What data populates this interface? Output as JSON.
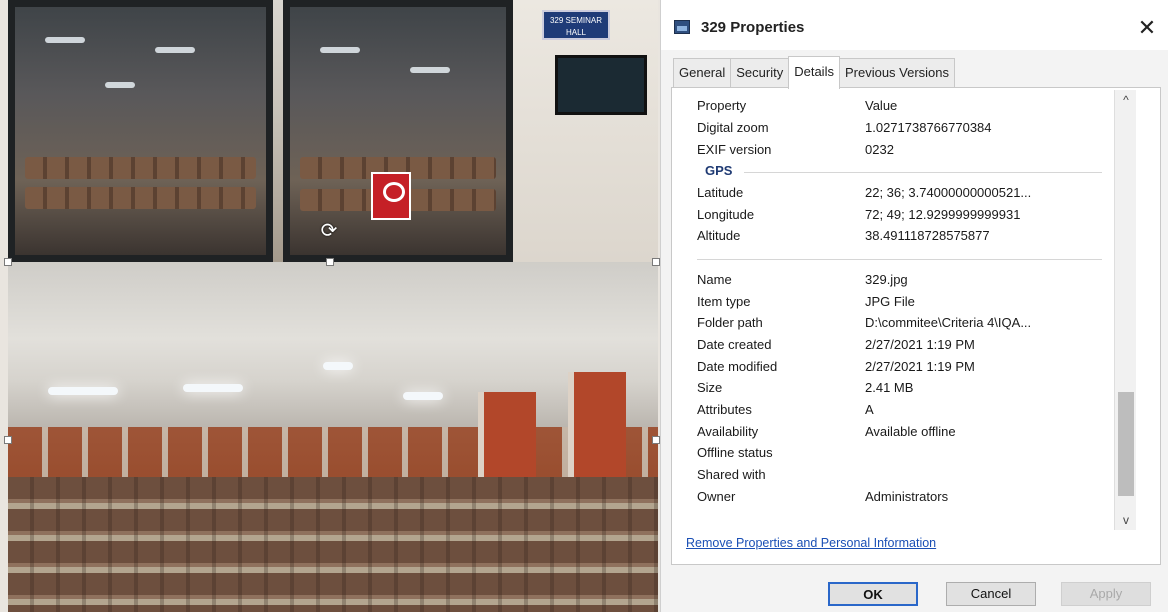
{
  "dialog": {
    "title": "329 Properties",
    "close_glyph": "✕",
    "tabs": [
      {
        "label": "General",
        "active": false
      },
      {
        "label": "Security",
        "active": false
      },
      {
        "label": "Details",
        "active": true
      },
      {
        "label": "Previous Versions",
        "active": false
      }
    ],
    "columns": {
      "property": "Property",
      "value": "Value"
    },
    "rows": [
      {
        "key": "Digital zoom",
        "value": "1.0271738766770384"
      },
      {
        "key": "EXIF version",
        "value": "0232"
      },
      {
        "group": "GPS"
      },
      {
        "key": "Latitude",
        "value": "22; 36; 3.74000000000521..."
      },
      {
        "key": "Longitude",
        "value": "72; 49; 12.9299999999931"
      },
      {
        "key": "Altitude",
        "value": "38.491118728575877"
      },
      {
        "group": ""
      },
      {
        "key": "Name",
        "value": "329.jpg"
      },
      {
        "key": "Item type",
        "value": "JPG File"
      },
      {
        "key": "Folder path",
        "value": "D:\\commitee\\Criteria 4\\IQA..."
      },
      {
        "key": "Date created",
        "value": "2/27/2021 1:19 PM"
      },
      {
        "key": "Date modified",
        "value": "2/27/2021 1:19 PM"
      },
      {
        "key": "Size",
        "value": "2.41 MB"
      },
      {
        "key": "Attributes",
        "value": "A"
      },
      {
        "key": "Availability",
        "value": "Available offline"
      },
      {
        "key": "Offline status",
        "value": ""
      },
      {
        "key": "Shared with",
        "value": ""
      },
      {
        "key": "Owner",
        "value": "Administrators"
      }
    ],
    "scroll_up_glyph": "^",
    "scroll_down_glyph": "v",
    "remove_link": "Remove Properties and Personal Information",
    "buttons": {
      "ok": "OK",
      "cancel": "Cancel",
      "apply": "Apply"
    }
  },
  "photo": {
    "sign_text": "329 SEMINAR HALL",
    "rotate_glyph": "⟳"
  },
  "icons": {
    "title": "image-file-icon",
    "close": "close-icon",
    "rotate": "rotate-icon",
    "layout": "layout-options-icon"
  },
  "colors": {
    "link": "#1a4fb5",
    "group_header": "#1f3a73",
    "ok_border": "#2a67c9"
  }
}
